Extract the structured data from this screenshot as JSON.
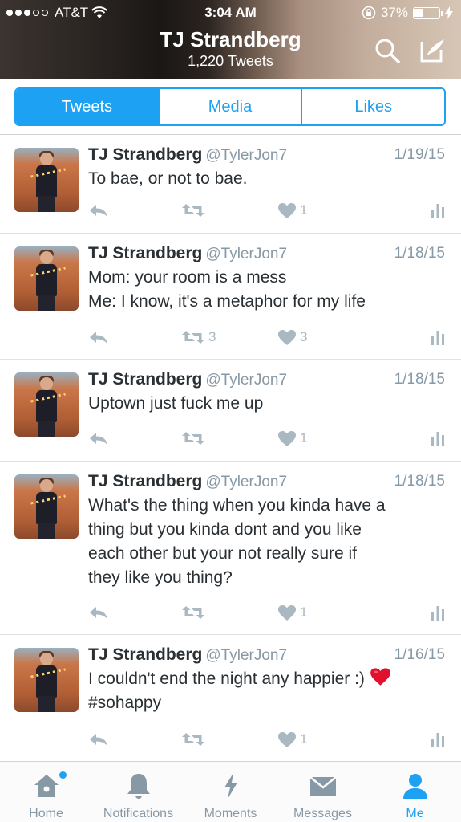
{
  "status_bar": {
    "carrier": "AT&T",
    "time": "3:04 AM",
    "battery": "37%",
    "battery_level": 0.37
  },
  "profile": {
    "name": "TJ Strandberg",
    "tweet_count": "1,220 Tweets"
  },
  "header_icons": [
    "search-icon",
    "compose-icon"
  ],
  "tabs": [
    {
      "label": "Tweets",
      "active": true
    },
    {
      "label": "Media",
      "active": false
    },
    {
      "label": "Likes",
      "active": false
    }
  ],
  "tweets": [
    {
      "name": "TJ Strandberg",
      "handle": "@TylerJon7",
      "date": "1/19/15",
      "lines": [
        "To bae, or not to bae."
      ],
      "retweets": "",
      "likes": "1"
    },
    {
      "name": "TJ Strandberg",
      "handle": "@TylerJon7",
      "date": "1/18/15",
      "lines": [
        "Mom: your room is a mess",
        "Me: I know, it's a metaphor for my life"
      ],
      "retweets": "3",
      "likes": "3"
    },
    {
      "name": "TJ Strandberg",
      "handle": "@TylerJon7",
      "date": "1/18/15",
      "lines": [
        "Uptown just fuck me up"
      ],
      "retweets": "",
      "likes": "1"
    },
    {
      "name": "TJ Strandberg",
      "handle": "@TylerJon7",
      "date": "1/18/15",
      "lines": [
        "What's the thing when you kinda have a",
        "thing but you kinda dont and you like",
        "each other but your not really sure if",
        "they like you thing?"
      ],
      "retweets": "",
      "likes": "1"
    },
    {
      "name": "TJ Strandberg",
      "handle": "@TylerJon7",
      "date": "1/16/15",
      "lines": [
        "I couldn't end the night any happier :)",
        "#sohappy"
      ],
      "emoji_after_line": 0,
      "emoji": "red-heart",
      "retweets": "",
      "likes": "1"
    }
  ],
  "bottom_nav": [
    {
      "label": "Home",
      "icon": "home-icon",
      "active": false,
      "badge": true
    },
    {
      "label": "Notifications",
      "icon": "bell-icon",
      "active": false,
      "badge": false
    },
    {
      "label": "Moments",
      "icon": "lightning-icon",
      "active": false,
      "badge": false
    },
    {
      "label": "Messages",
      "icon": "envelope-icon",
      "active": false,
      "badge": false
    },
    {
      "label": "Me",
      "icon": "person-icon",
      "active": true,
      "badge": false
    }
  ],
  "colors": {
    "accent": "#1da1f2",
    "muted": "#8899a6",
    "icon_gray": "#aab8c2",
    "text": "#292f33",
    "heart_red": "#e0102e"
  }
}
